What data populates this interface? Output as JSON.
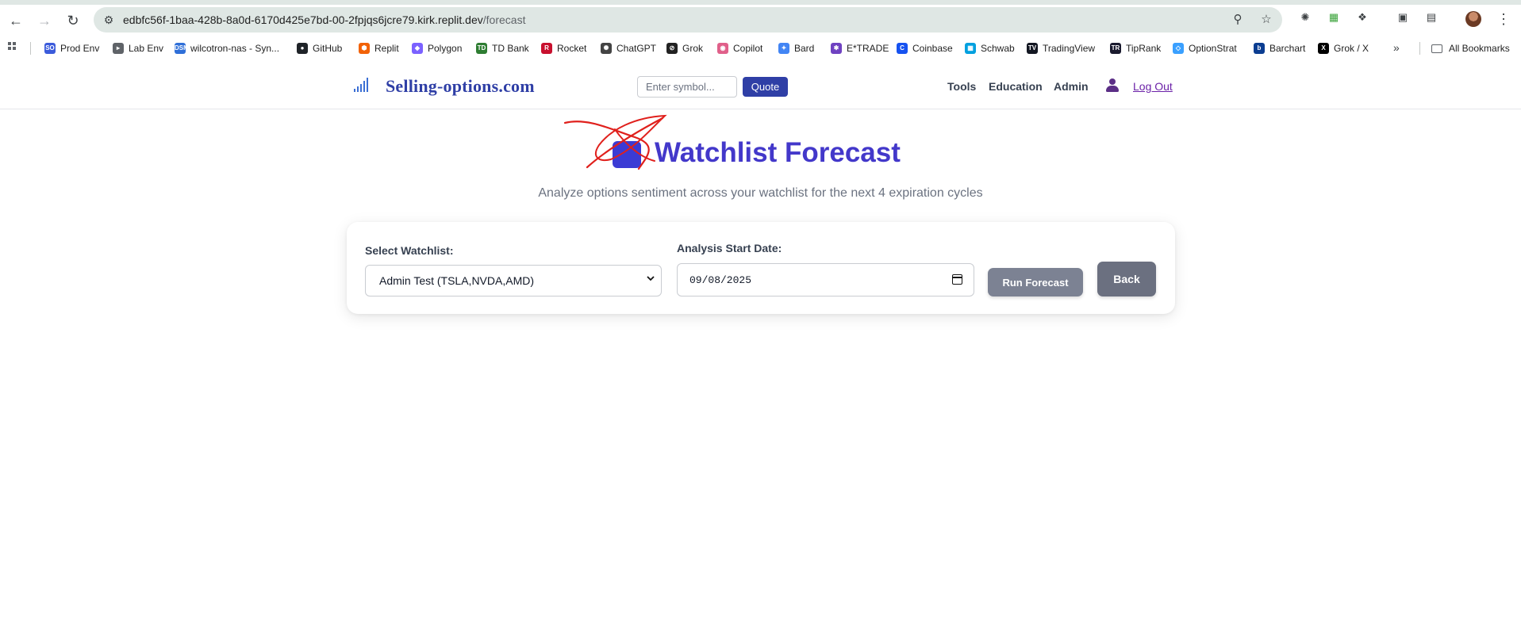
{
  "browser": {
    "url_host": "edbfc56f-1baa-428b-8a0d-6170d425e7bd-00-2fpjqs6jcre79.kirk.replit.dev",
    "url_path": "/forecast",
    "back_icon": "arrow-left-icon",
    "forward_icon": "arrow-right-icon",
    "reload_icon": "reload-icon",
    "bookmarks": [
      {
        "label": "Prod Env",
        "icon": "SO",
        "color": "#3b5bdb"
      },
      {
        "label": "Lab Env",
        "icon": "▸",
        "color": "#5f6368"
      },
      {
        "label": "wilcotron-nas - Syn...",
        "icon": "DSM",
        "color": "#2f6fd8"
      },
      {
        "label": "GitHub",
        "icon": "●",
        "color": "#1f2328"
      },
      {
        "label": "Replit",
        "icon": "⬢",
        "color": "#f26207"
      },
      {
        "label": "Polygon",
        "icon": "◆",
        "color": "#7b61ff"
      },
      {
        "label": "TD Bank",
        "icon": "TD",
        "color": "#2e7d32"
      },
      {
        "label": "Rocket",
        "icon": "R",
        "color": "#c8102e"
      },
      {
        "label": "ChatGPT",
        "icon": "✺",
        "color": "#444444"
      },
      {
        "label": "Grok",
        "icon": "⊘",
        "color": "#222222"
      },
      {
        "label": "Copilot",
        "icon": "◉",
        "color": "#e0608a"
      },
      {
        "label": "Bard",
        "icon": "✦",
        "color": "#4285f4"
      },
      {
        "label": "E*TRADE",
        "icon": "✱",
        "color": "#6f42c1"
      },
      {
        "label": "Coinbase",
        "icon": "C",
        "color": "#1652f0"
      },
      {
        "label": "Schwab",
        "icon": "▦",
        "color": "#00a0df"
      },
      {
        "label": "TradingView",
        "icon": "TV",
        "color": "#131722"
      },
      {
        "label": "TipRank",
        "icon": "TR",
        "color": "#1a1a2e"
      },
      {
        "label": "OptionStrat",
        "icon": "◇",
        "color": "#3aa0ff"
      },
      {
        "label": "Barchart",
        "icon": "b",
        "color": "#0b3d91"
      },
      {
        "label": "Grok / X",
        "icon": "X",
        "color": "#000000"
      }
    ],
    "all_bookmarks": "All Bookmarks"
  },
  "header": {
    "brand": "Selling-options.com",
    "symbol_placeholder": "Enter symbol...",
    "quote_label": "Quote",
    "nav": [
      "Tools",
      "Education",
      "Admin"
    ],
    "logout": "Log Out"
  },
  "main": {
    "title": "Watchlist Forecast",
    "subtitle": "Analyze options sentiment across your watchlist for the next 4 expiration cycles",
    "watchlist_label": "Select Watchlist:",
    "watchlist_value": "Admin Test (TSLA,NVDA,AMD)",
    "date_label": "Analysis Start Date:",
    "date_value": "09/08/2025",
    "run_label": "Run Forecast",
    "back_label": "Back"
  },
  "colors": {
    "brand": "#2f3fa6",
    "title": "#4338ca",
    "run_button": "#7c8293",
    "back_button": "#6b7080",
    "annotation_scribble": "#e0201c"
  }
}
